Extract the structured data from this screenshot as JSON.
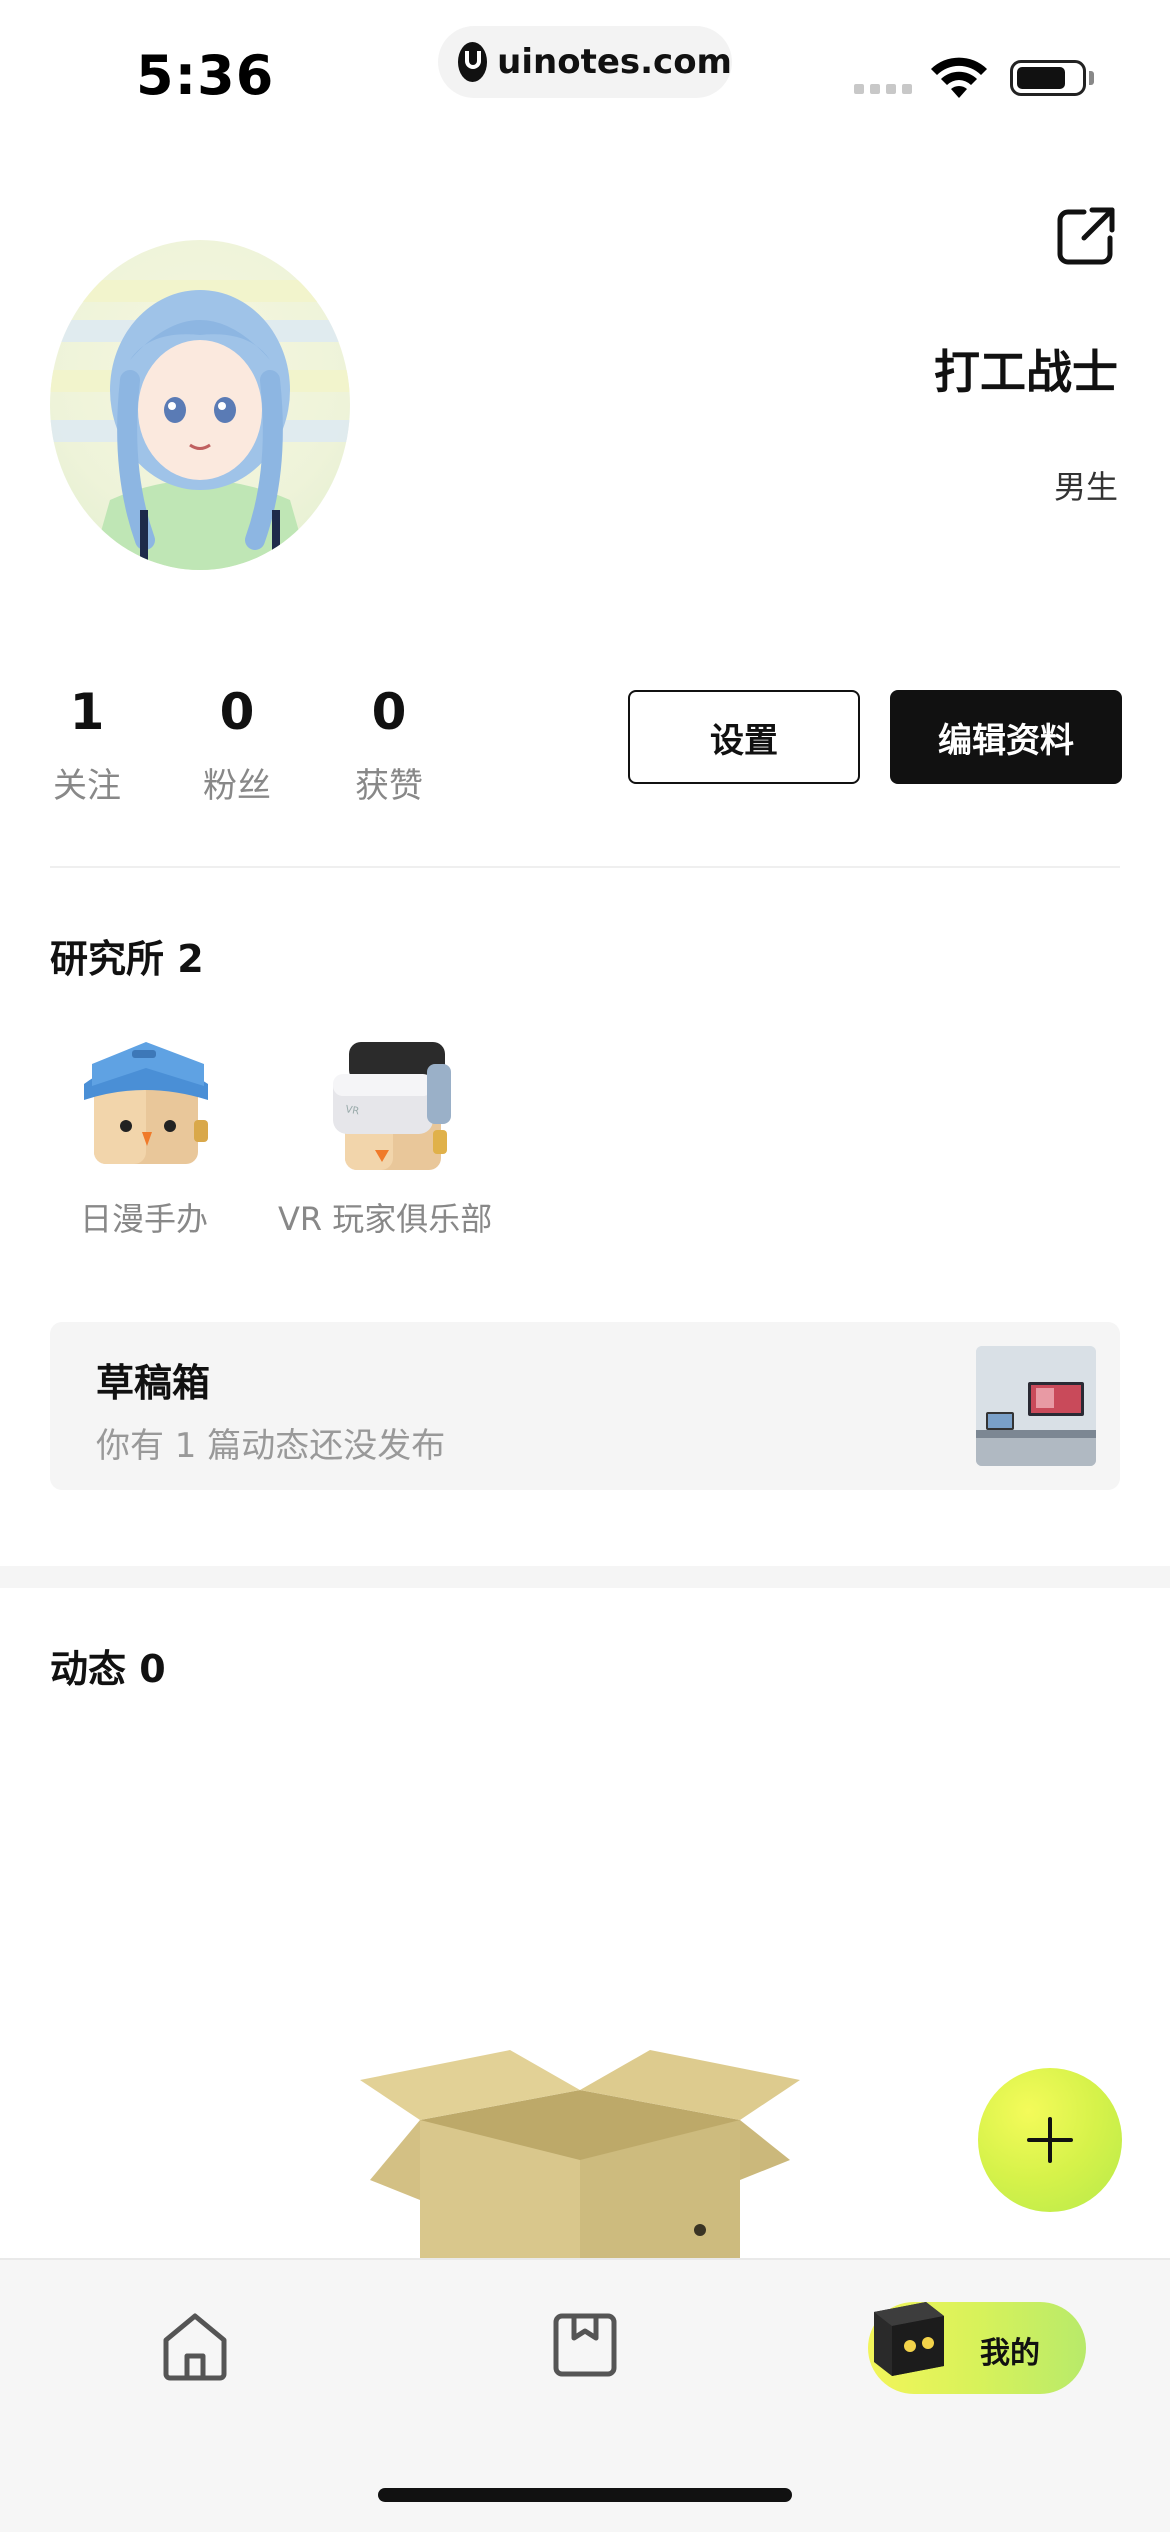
{
  "status_bar": {
    "time": "5:36",
    "url": "uinotes.com"
  },
  "profile": {
    "username": "打工战士",
    "gender": "男生",
    "stats": [
      {
        "value": "1",
        "label": "关注"
      },
      {
        "value": "0",
        "label": "粉丝"
      },
      {
        "value": "0",
        "label": "获赞"
      }
    ],
    "settings_label": "设置",
    "edit_label": "编辑资料"
  },
  "institutes": {
    "title": "研究所 2",
    "items": [
      {
        "label": "日漫手办",
        "icon": "blue-cap-cube-icon"
      },
      {
        "label": "VR 玩家俱乐部",
        "icon": "vr-headset-cube-icon"
      }
    ]
  },
  "draft": {
    "title": "草稿箱",
    "subtitle": "你有 1 篇动态还没发布"
  },
  "feed": {
    "title": "动态 0"
  },
  "tabbar": {
    "me_label": "我的"
  },
  "colors": {
    "accent_yellow_green": "#d6f24a",
    "primary_dark": "#111111",
    "muted_text": "#888888"
  }
}
